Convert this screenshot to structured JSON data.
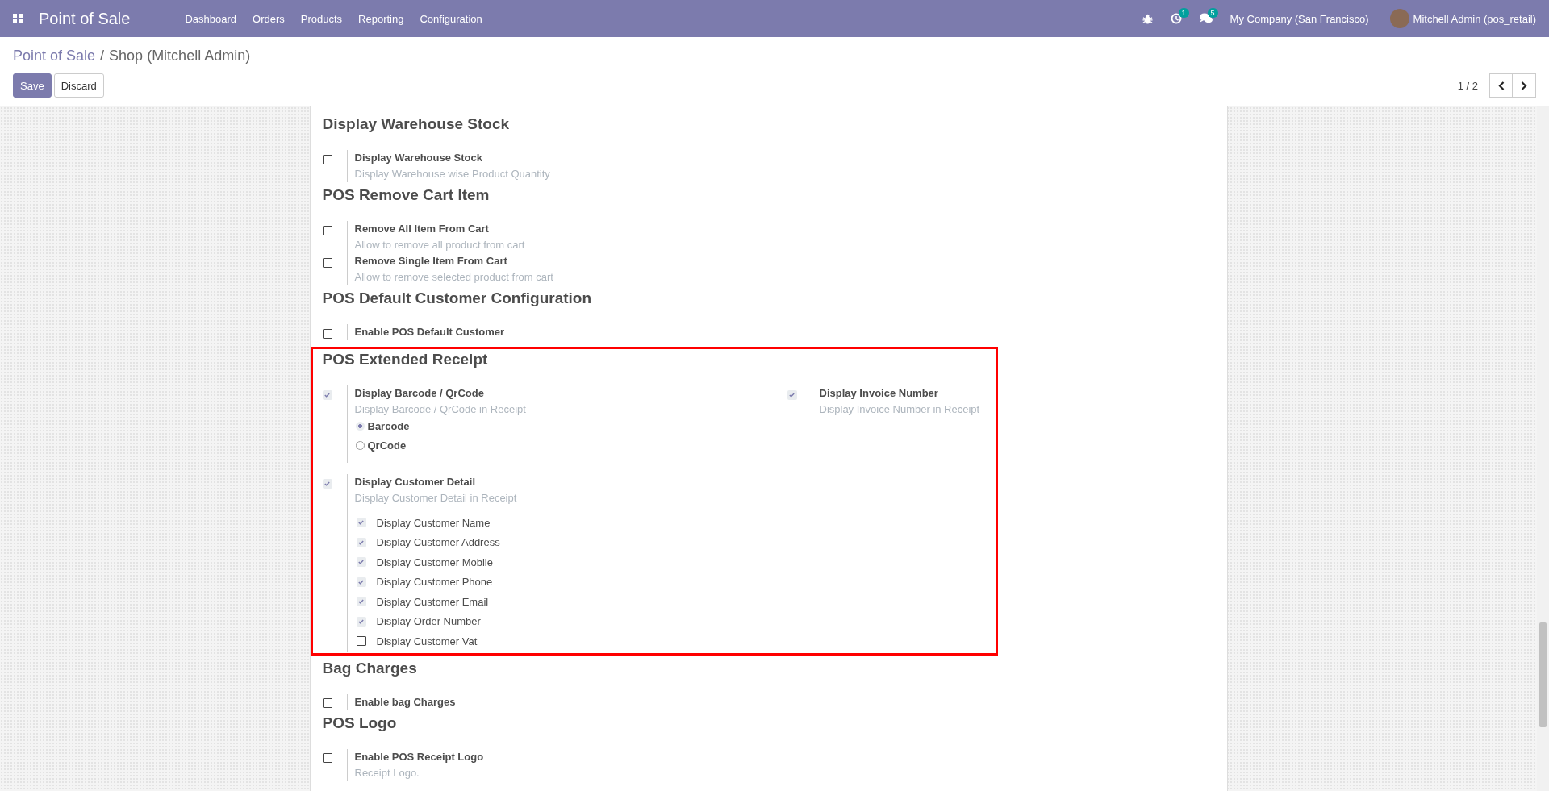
{
  "navbar": {
    "app_title": "Point of Sale",
    "menu": [
      "Dashboard",
      "Orders",
      "Products",
      "Reporting",
      "Configuration"
    ],
    "activity_count": "1",
    "message_count": "5",
    "company": "My Company (San Francisco)",
    "user": "Mitchell Admin (pos_retail)"
  },
  "breadcrumb": {
    "parent": "Point of Sale",
    "separator": "/",
    "current": "Shop (Mitchell Admin)"
  },
  "buttons": [
    {
      "label": "Save",
      "kind": "primary"
    },
    {
      "label": "Discard",
      "kind": "secondary"
    }
  ],
  "pager": "1 / 2",
  "sections": [
    {
      "title": "Display Warehouse Stock",
      "highlighted": false,
      "columns": [
        [
          {
            "label": "Display Warehouse Stock",
            "description": "Display Warehouse wise Product Quantity",
            "checked": false
          }
        ]
      ]
    },
    {
      "title": "POS Remove Cart Item",
      "highlighted": false,
      "columns": [
        [
          {
            "label": "Remove All Item From Cart",
            "description": "Allow to remove all product from cart",
            "checked": false
          },
          {
            "label": "Remove Single Item From Cart",
            "description": "Allow to remove selected product from cart",
            "checked": false
          }
        ]
      ]
    },
    {
      "title": "POS Default Customer Configuration",
      "highlighted": false,
      "columns": [
        [
          {
            "label": "Enable POS Default Customer",
            "checked": false
          }
        ]
      ]
    },
    {
      "title": "POS Extended Receipt",
      "highlighted": true,
      "columns": [
        [
          {
            "label": "Display Barcode / QrCode",
            "description": "Display Barcode / QrCode in Receipt",
            "checked": true,
            "options": [
              {
                "label": "Barcode",
                "selected": true
              },
              {
                "label": "QrCode",
                "selected": false
              }
            ]
          },
          {
            "label": "Display Customer Detail",
            "description": "Display Customer Detail in Receipt",
            "checked": true,
            "sub_items": [
              {
                "label": "Display Customer Name",
                "checked": true
              },
              {
                "label": "Display Customer Address",
                "checked": true
              },
              {
                "label": "Display Customer Mobile",
                "checked": true
              },
              {
                "label": "Display Customer Phone",
                "checked": true
              },
              {
                "label": "Display Customer Email",
                "checked": true
              },
              {
                "label": "Display Order Number",
                "checked": true
              },
              {
                "label": "Display Customer Vat",
                "checked": false
              }
            ]
          }
        ],
        [
          {
            "label": "Display Invoice Number",
            "description": "Display Invoice Number in Receipt",
            "checked": true
          }
        ]
      ]
    },
    {
      "title": "Bag Charges",
      "highlighted": false,
      "columns": [
        [
          {
            "label": "Enable bag Charges",
            "checked": false
          }
        ]
      ]
    },
    {
      "title": "POS Logo",
      "highlighted": false,
      "columns": [
        [
          {
            "label": "Enable POS Receipt Logo",
            "description": "Receipt Logo.",
            "checked": false
          }
        ]
      ]
    }
  ]
}
